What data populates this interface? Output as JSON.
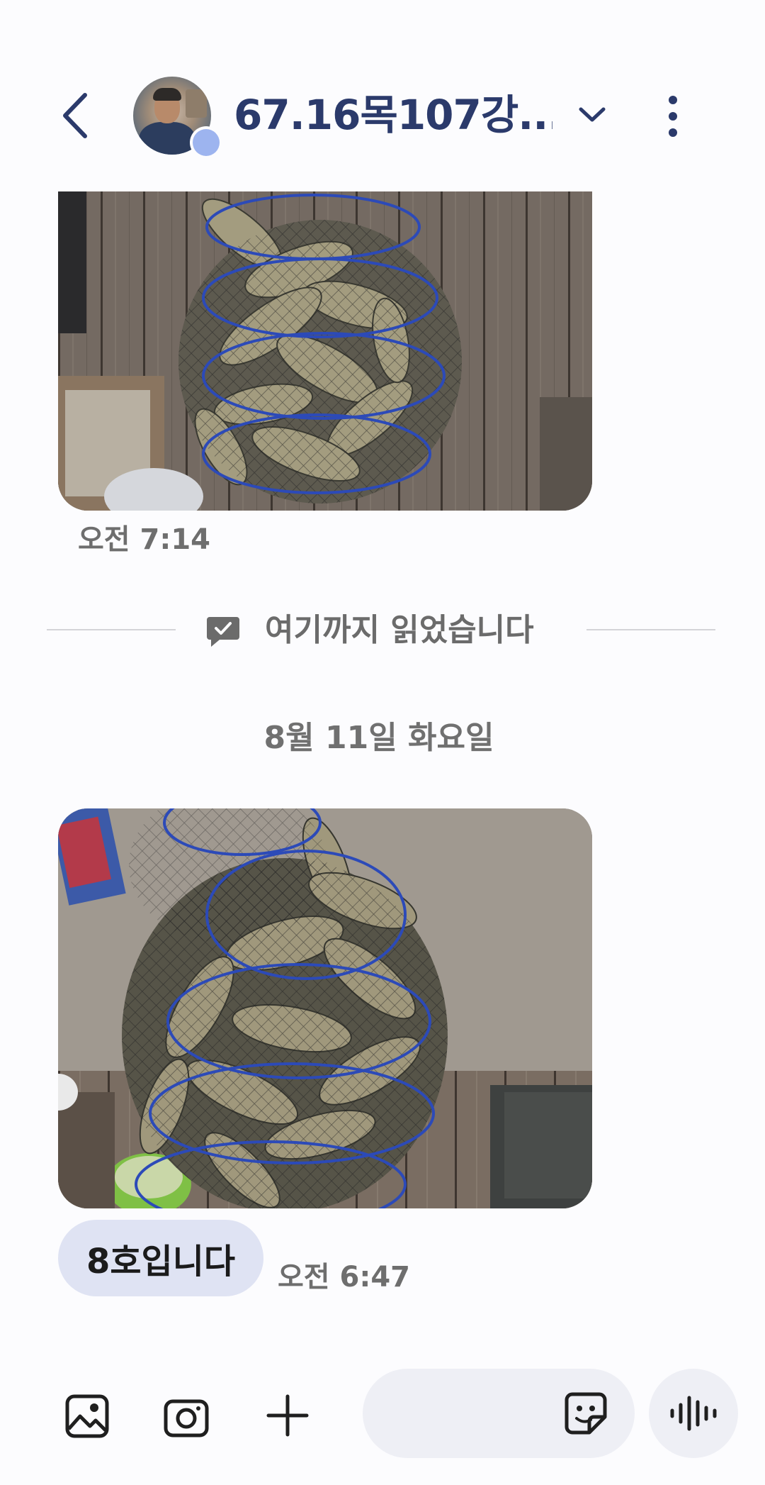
{
  "header": {
    "title": "67.16목107강...",
    "back_icon": "chevron-left-icon",
    "dropdown_icon": "chevron-down-icon",
    "more_icon": "more-vertical-icon",
    "title_color": "#2b3a6b"
  },
  "messages": [
    {
      "type": "image",
      "content": "fish-in-net-photo",
      "time": "오전 7:14"
    },
    {
      "type": "image",
      "content": "fish-in-net-photo",
      "text": "8호입니다",
      "time": "오전 6:47"
    }
  ],
  "read_marker": {
    "label": "여기까지 읽었습니다",
    "icon": "read-check-icon"
  },
  "date_separator": "8월 11일 화요일",
  "composer": {
    "input_value": "",
    "gallery_icon": "gallery-icon",
    "camera_icon": "camera-icon",
    "plus_icon": "plus-icon",
    "sticker_icon": "sticker-icon",
    "voice_icon": "voice-wave-icon",
    "bubble_color": "#dfe3f3"
  }
}
